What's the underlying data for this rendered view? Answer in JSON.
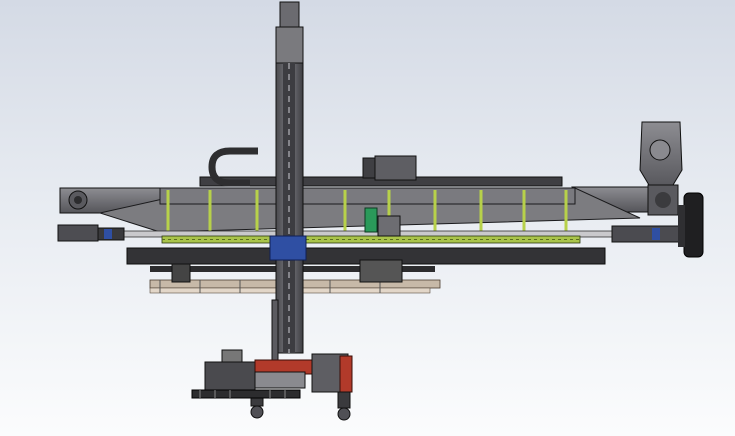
{
  "viewport": {
    "background_top": "#d4dae5",
    "background_bottom": "#fbfcfd",
    "view_type": "cad-3d-model-viewport"
  },
  "model": {
    "subject": "gantry-welding-manipulator-assembly",
    "colors": {
      "steel_dark": "#3b3b3d",
      "steel_mid": "#6e6e72",
      "steel_light": "#a9a9ad",
      "accent_green": "#b7d14a",
      "motor_green": "#2a9a5a",
      "accent_blue": "#2f4fa3",
      "accent_red": "#b23a2a",
      "edge": "#101010"
    },
    "icons": [
      "motor-icon",
      "wheel-icon",
      "welding-torch-icon"
    ]
  }
}
